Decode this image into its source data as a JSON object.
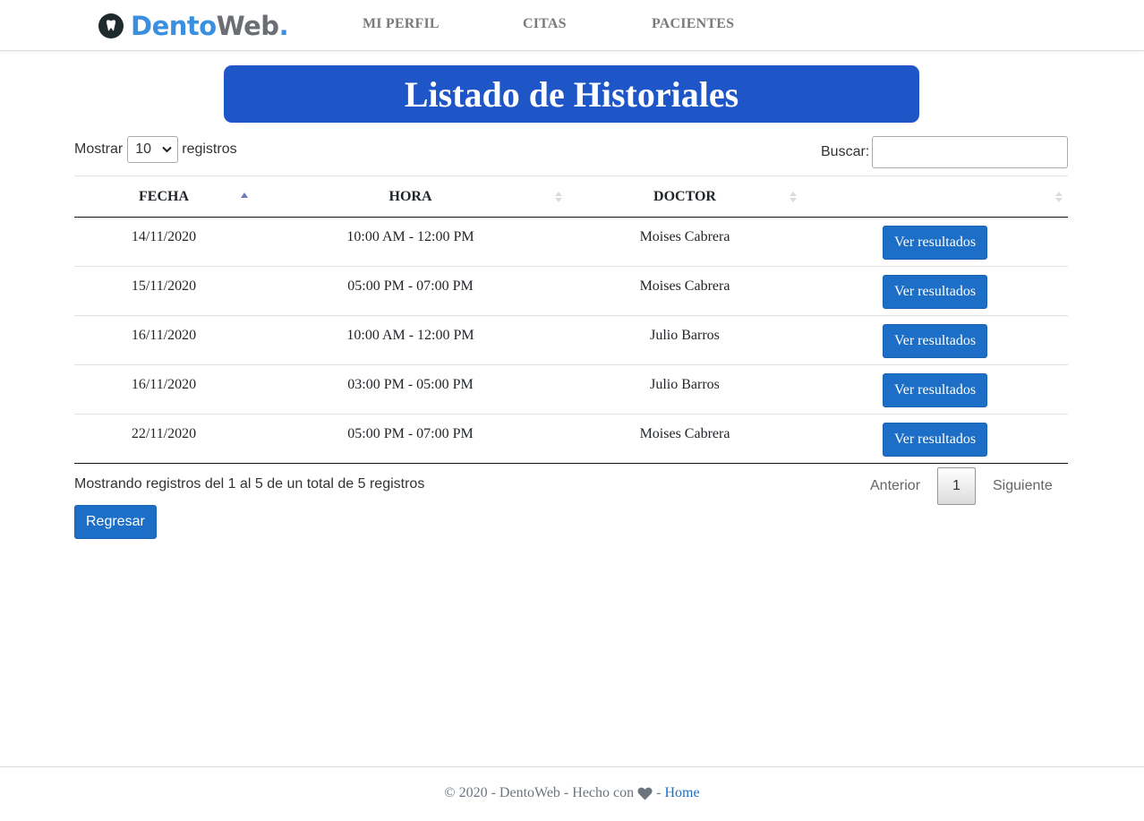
{
  "brand": {
    "part1": "Dento",
    "part2": "Web",
    "dot": "."
  },
  "nav": {
    "items": [
      {
        "label": "MI PERFIL"
      },
      {
        "label": "CITAS"
      },
      {
        "label": "PACIENTES"
      }
    ]
  },
  "title": "Listado de Historiales",
  "controls": {
    "show_prefix": "Mostrar",
    "show_value": "10",
    "show_suffix": "registros",
    "search_label": "Buscar:",
    "search_value": ""
  },
  "table": {
    "columns": [
      "FECHA",
      "HORA",
      "DOCTOR",
      ""
    ],
    "rows": [
      {
        "fecha": "14/11/2020",
        "hora": "10:00 AM - 12:00 PM",
        "doctor": "Moises Cabrera",
        "action": "Ver resultados"
      },
      {
        "fecha": "15/11/2020",
        "hora": "05:00 PM - 07:00 PM",
        "doctor": "Moises Cabrera",
        "action": "Ver resultados"
      },
      {
        "fecha": "16/11/2020",
        "hora": "10:00 AM - 12:00 PM",
        "doctor": "Julio Barros",
        "action": "Ver resultados"
      },
      {
        "fecha": "16/11/2020",
        "hora": "03:00 PM - 05:00 PM",
        "doctor": "Julio Barros",
        "action": "Ver resultados"
      },
      {
        "fecha": "22/11/2020",
        "hora": "05:00 PM - 07:00 PM",
        "doctor": "Moises Cabrera",
        "action": "Ver resultados"
      }
    ]
  },
  "info": "Mostrando registros del 1 al 5 de un total de 5 registros",
  "pagination": {
    "prev": "Anterior",
    "current": "1",
    "next": "Siguiente"
  },
  "back_button": "Regresar",
  "footer": {
    "text": "© 2020 - DentoWeb - Hecho con",
    "dash": "-",
    "link": "Home"
  },
  "colors": {
    "accent": "#1e56c8",
    "button": "#1c6ec6",
    "brand_blue": "#3a8fe0",
    "brand_gray": "#6b6f73"
  },
  "icons": [
    "tooth-icon",
    "sort-asc-icon",
    "sort-both-icon",
    "heart-icon",
    "chevron-down-icon"
  ]
}
